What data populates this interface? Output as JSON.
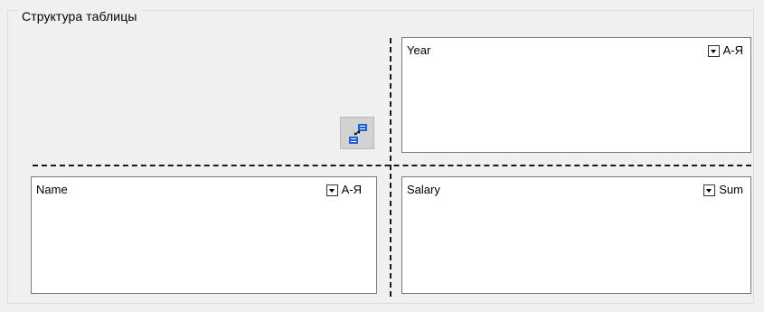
{
  "group": {
    "title": "Структура таблицы"
  },
  "columns_area": {
    "field": "Year",
    "sort_label": "А-Я",
    "dropdown_icon": "chevron-down-icon"
  },
  "rows_area": {
    "field": "Name",
    "sort_label": "А-Я",
    "dropdown_icon": "chevron-down-icon"
  },
  "values_area": {
    "field": "Salary",
    "aggregate_label": "Sum",
    "dropdown_icon": "chevron-down-icon"
  },
  "swap_button": {
    "icon": "swap-axes-icon",
    "colors": {
      "face": "#d2d2d2",
      "accent": "#1f5fd8"
    }
  }
}
